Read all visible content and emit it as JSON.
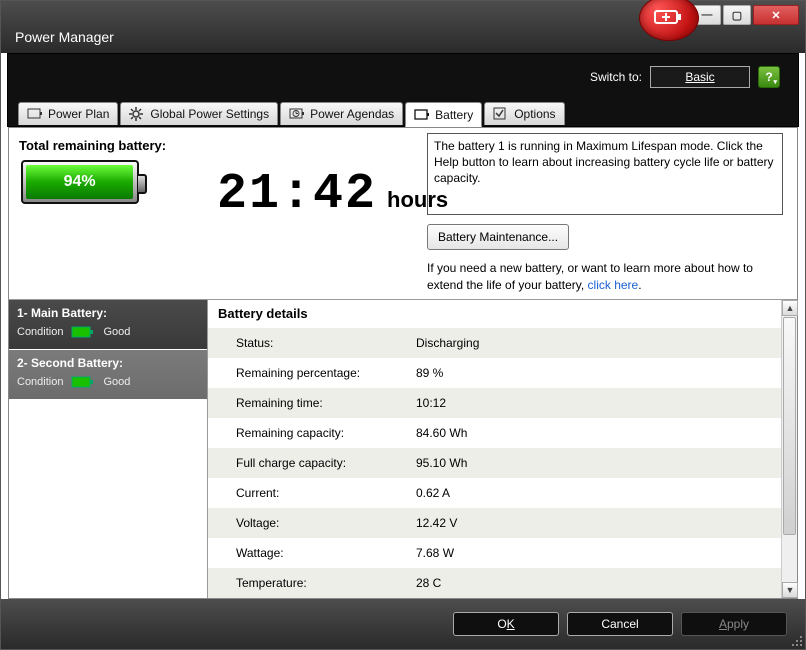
{
  "window": {
    "title": "Power Manager",
    "switch_label": "Switch to:",
    "switch_button": "Basic",
    "help_symbol": "?"
  },
  "win_controls": {
    "min": "_",
    "max": "▭",
    "close": "✕"
  },
  "tabs": [
    {
      "label": "Power Plan"
    },
    {
      "label": "Global Power Settings"
    },
    {
      "label": "Power Agendas"
    },
    {
      "label": "Battery"
    },
    {
      "label": "Options"
    }
  ],
  "total_remaining_label": "Total remaining battery:",
  "total_percent": "94%",
  "remaining_time_digits": "21:42",
  "remaining_time_unit": "hours",
  "status_message": "The battery 1 is running in Maximum Lifespan mode. Click the Help button to learn about increasing battery cycle life or battery capacity.",
  "maintenance_button": "Battery Maintenance...",
  "need_battery_prefix": "If you need a new battery, or want to learn more about how to extend the life of your battery, ",
  "need_battery_link": "click here",
  "need_battery_suffix": ".",
  "sidebar": {
    "main": {
      "title": "1- Main Battery:",
      "cond_label": "Condition",
      "cond_value": "Good"
    },
    "second": {
      "title": "2- Second Battery:",
      "cond_label": "Condition",
      "cond_value": "Good"
    }
  },
  "details_header": "Battery details",
  "details": {
    "status_label": "Status:",
    "status_value": "Discharging",
    "pct_label": "Remaining percentage:",
    "pct_value": "89 %",
    "time_label": "Remaining time:",
    "time_value": "10:12",
    "cap_label": "Remaining capacity:",
    "cap_value": "84.60 Wh",
    "full_label": "Full charge capacity:",
    "full_value": "95.10 Wh",
    "current_label": "Current:",
    "current_value": "0.62 A",
    "voltage_label": "Voltage:",
    "voltage_value": "12.42 V",
    "wattage_label": "Wattage:",
    "wattage_value": "7.68 W",
    "temp_label": "Temperature:",
    "temp_value": "28 C"
  },
  "footer": {
    "ok_pre": "O",
    "ok_ul": "K",
    "cancel": "Cancel",
    "apply_ul": "A",
    "apply_post": "pply"
  },
  "colors": {
    "battery_green": "#2db800",
    "accent_red": "#c01010"
  }
}
